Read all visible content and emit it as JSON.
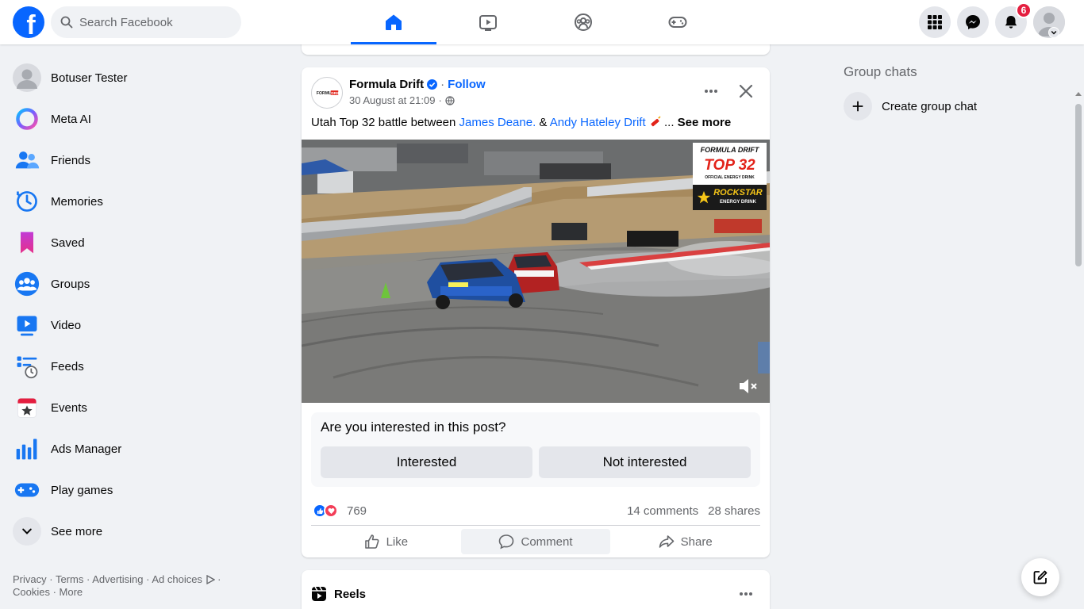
{
  "header": {
    "search_placeholder": "Search Facebook",
    "notifications_count": "6",
    "accent_color": "#0866ff",
    "tabs": [
      {
        "name": "home",
        "icon": "home-icon",
        "active": true
      },
      {
        "name": "video",
        "icon": "video-icon",
        "active": false
      },
      {
        "name": "groups",
        "icon": "groups-icon",
        "active": false
      },
      {
        "name": "gaming",
        "icon": "gaming-icon",
        "active": false
      }
    ]
  },
  "sidebar": {
    "items": [
      {
        "label": "Botuser Tester",
        "icon": "avatar"
      },
      {
        "label": "Meta AI",
        "icon": "meta-ai-icon"
      },
      {
        "label": "Friends",
        "icon": "friends-icon"
      },
      {
        "label": "Memories",
        "icon": "memories-icon"
      },
      {
        "label": "Saved",
        "icon": "saved-icon"
      },
      {
        "label": "Groups",
        "icon": "groups-icon"
      },
      {
        "label": "Video",
        "icon": "video-icon"
      },
      {
        "label": "Feeds",
        "icon": "feeds-icon"
      },
      {
        "label": "Events",
        "icon": "events-icon"
      },
      {
        "label": "Ads Manager",
        "icon": "ads-manager-icon"
      },
      {
        "label": "Play games",
        "icon": "games-icon"
      },
      {
        "label": "See more",
        "icon": "chevron-down-icon"
      }
    ],
    "footer": {
      "privacy": "Privacy",
      "terms": "Terms",
      "advertising": "Advertising",
      "ad_choices": "Ad choices",
      "cookies": "Cookies",
      "more": "More"
    }
  },
  "post": {
    "page_name": "Formula Drift",
    "follow_label": "Follow",
    "timestamp": "30 August at 21:09",
    "text_prefix": "Utah Top 32 battle between ",
    "mention_1": "James Deane.",
    "text_mid": " & ",
    "mention_2": "Andy Hateley Drift",
    "text_suffix": " ... ",
    "see_more": "See more",
    "sponsor": {
      "brand": "FORMULA DRIFT",
      "event": "TOP 32",
      "official": "OFFICIAL ENERGY DRINK",
      "drink": "ROCKSTAR",
      "drink_sub": "ENERGY DRINK"
    },
    "interest_question": "Are you interested in this post?",
    "interested_label": "Interested",
    "not_interested_label": "Not interested",
    "reaction_count": "769",
    "comments": "14 comments",
    "shares": "28 shares",
    "like_label": "Like",
    "comment_label": "Comment",
    "share_label": "Share"
  },
  "reels": {
    "title": "Reels"
  },
  "right": {
    "group_chats_title": "Group chats",
    "create_group_chat": "Create group chat"
  }
}
